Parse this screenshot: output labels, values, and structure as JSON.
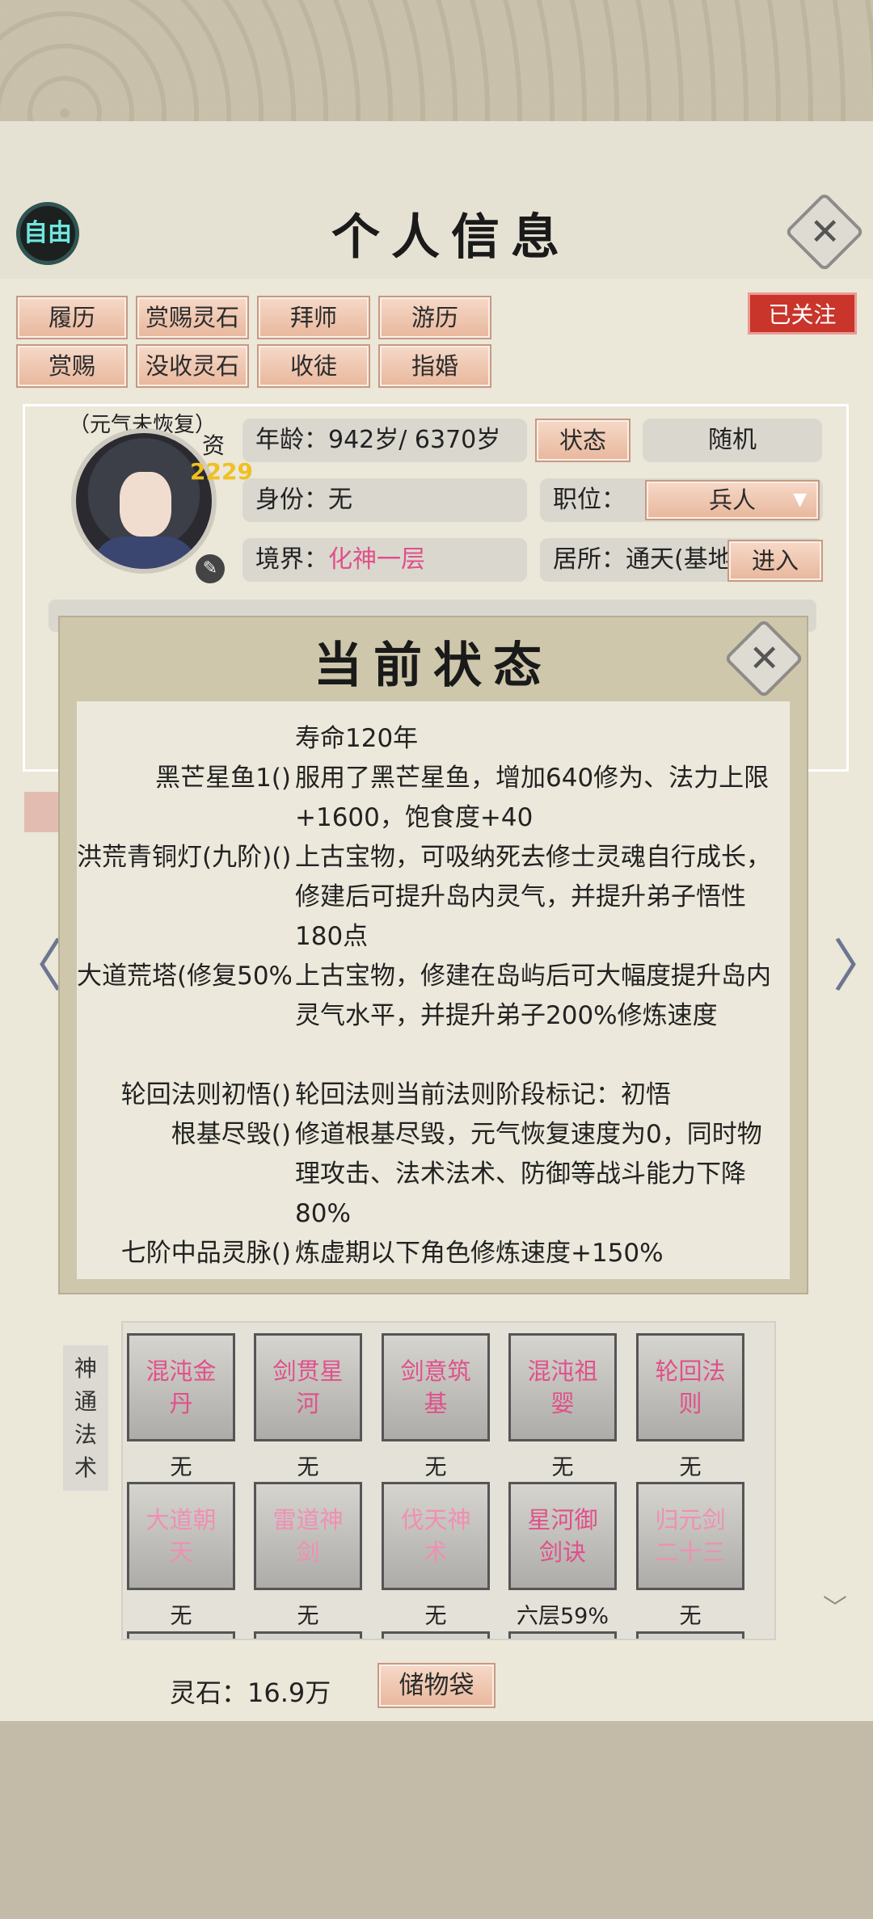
{
  "header": {
    "title": "个人信息",
    "free_badge": "自由",
    "followed_tag": "已关注"
  },
  "action_buttons": [
    [
      "履历",
      "赏赐灵石",
      "拜师",
      "游历"
    ],
    [
      "赏赐",
      "没收灵石",
      "收徒",
      "指婚"
    ]
  ],
  "profile": {
    "status_note": "（元气未恢复）",
    "aptitude_label": "资",
    "aptitude_value": "2229",
    "age_label": "年龄：",
    "age_value": "942岁/ 6370岁",
    "state_button": "状态",
    "random_button": "随机",
    "identity_label": "身份：",
    "identity_value": "无",
    "position_label": "职位：",
    "position_value": "兵人",
    "realm_label": "境界：",
    "realm_value": "化神一层",
    "residence_label": "居所：",
    "residence_value": "通天(基地",
    "enter_button": "进入"
  },
  "status_popup": {
    "title": "当前状态",
    "partial_top_value": "寿命120年",
    "entries": [
      {
        "name": "黑芒星鱼1()",
        "desc": "服用了黑芒星鱼，增加640修为、法力上限+1600，饱食度+40"
      },
      {
        "name": "洪荒青铜灯(九阶)()",
        "desc": "上古宝物，可吸纳死去修士灵魂自行成长，修建后可提升岛内灵气，并提升弟子悟性180点"
      },
      {
        "name": "大道荒塔(修复50%)()",
        "desc": "上古宝物，修建在岛屿后可大幅度提升岛内灵气水平，并提升弟子200%修炼速度"
      },
      {
        "name": "轮回法则初悟()",
        "desc": "轮回法则当前法则阶段标记：初悟"
      },
      {
        "name": "根基尽毁()",
        "desc": "修道根基尽毁，元气恢复速度为0，同时物理攻击、法术法术、防御等战斗能力下降80%"
      },
      {
        "name": "七阶中品灵脉()",
        "desc": "炼虚期以下角色修炼速度+150%"
      }
    ]
  },
  "skills": {
    "side_label": [
      "神",
      "通",
      "法",
      "术"
    ],
    "items": [
      {
        "name": "混沌金丹",
        "level": "无"
      },
      {
        "name": "剑贯星河",
        "level": "无"
      },
      {
        "name": "剑意筑基",
        "level": "无"
      },
      {
        "name": "混沌祖婴",
        "level": "无"
      },
      {
        "name": "轮回法则",
        "level": "无"
      },
      {
        "name": "大道朝天",
        "level": "无"
      },
      {
        "name": "雷道神剑",
        "level": "无"
      },
      {
        "name": "伐天神术",
        "level": "无"
      },
      {
        "name": "星河御剑诀",
        "level": "六层59%"
      },
      {
        "name": "归元剑二十三",
        "level": "无"
      }
    ]
  },
  "footer": {
    "stones_label": "灵石：16.9万",
    "bag_button": "储物袋"
  }
}
